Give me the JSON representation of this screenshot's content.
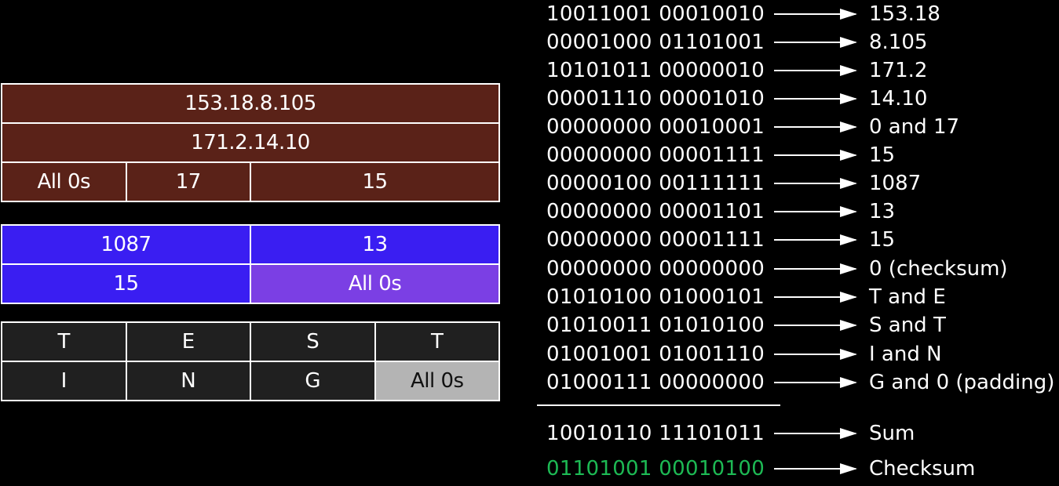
{
  "pseudo_header": {
    "source_ip": "153.18.8.105",
    "dest_ip": "171.2.14.10",
    "zeros": "All 0s",
    "protocol": "17",
    "length": "15"
  },
  "udp_header": {
    "source_port": "1087",
    "dest_port": "13",
    "length": "15",
    "checksum": "All 0s"
  },
  "data": {
    "row1": [
      "T",
      "E",
      "S",
      "T"
    ],
    "row2": [
      "I",
      "N",
      "G"
    ],
    "padding": "All 0s"
  },
  "calculation": {
    "rows": [
      {
        "bin": "10011001  00010010",
        "result": "153.18"
      },
      {
        "bin": "00001000  01101001",
        "result": "8.105"
      },
      {
        "bin": "10101011  00000010",
        "result": "171.2"
      },
      {
        "bin": "00001110  00001010",
        "result": "14.10"
      },
      {
        "bin": "00000000  00010001",
        "result": "0 and 17"
      },
      {
        "bin": "00000000  00001111",
        "result": "15"
      },
      {
        "bin": "00000100  00111111",
        "result": "1087"
      },
      {
        "bin": "00000000  00001101",
        "result": "13"
      },
      {
        "bin": "00000000  00001111",
        "result": "15"
      },
      {
        "bin": "00000000  00000000",
        "result": "0 (checksum)"
      },
      {
        "bin": "01010100  01000101",
        "result": "T and E"
      },
      {
        "bin": "01010011  01010100",
        "result": "S and T"
      },
      {
        "bin": "01001001  01001110",
        "result": "I and N"
      },
      {
        "bin": "01000111  00000000",
        "result": "G and 0 (padding)"
      }
    ],
    "sum": {
      "bin": "10010110  11101011",
      "result": "Sum"
    },
    "checksum": {
      "bin": "01101001  00010100",
      "result": "Checksum"
    }
  },
  "colors": {
    "pseudo_header": "#5a2218",
    "udp_header": "#3a1ef2",
    "udp_checksum": "#7b3fe4",
    "data": "#202020",
    "padding": "#b4b4b4",
    "checksum_text": "#1db954"
  }
}
